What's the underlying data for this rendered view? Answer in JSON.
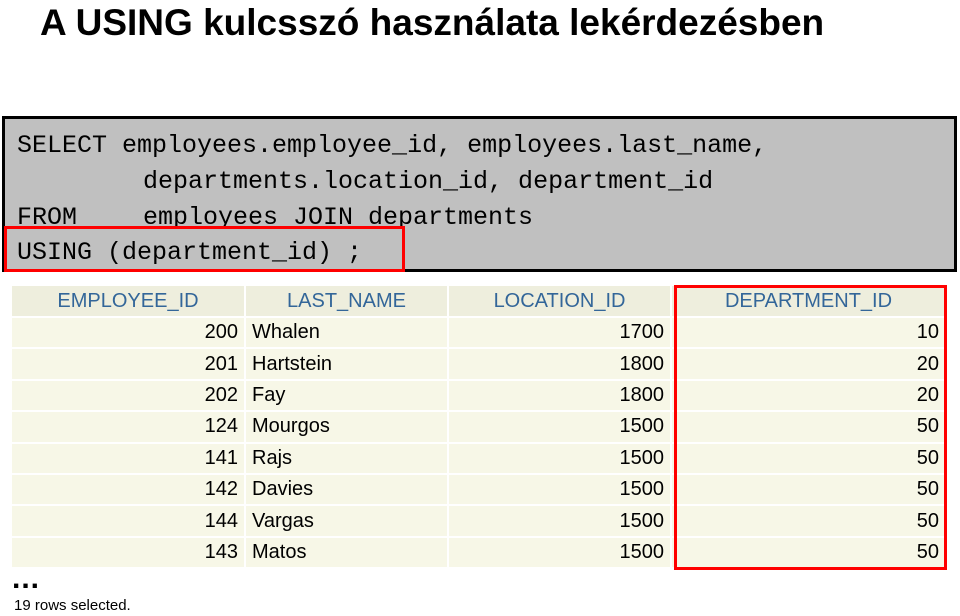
{
  "title": "A USING kulcsszó használata lekérdezésben",
  "sql": {
    "line1": "SELECT employees.employee_id, employees.last_name,",
    "line2": "departments.location_id, department_id",
    "line3_keyword": "FROM",
    "line3_rest": "employees JOIN departments",
    "line4": "USING (department_id) ;"
  },
  "table": {
    "headers": [
      "EMPLOYEE_ID",
      "LAST_NAME",
      "LOCATION_ID",
      "DEPARTMENT_ID"
    ],
    "rows": [
      [
        "200",
        "Whalen",
        "1700",
        "10"
      ],
      [
        "201",
        "Hartstein",
        "1800",
        "20"
      ],
      [
        "202",
        "Fay",
        "1800",
        "20"
      ],
      [
        "124",
        "Mourgos",
        "1500",
        "50"
      ],
      [
        "141",
        "Rajs",
        "1500",
        "50"
      ],
      [
        "142",
        "Davies",
        "1500",
        "50"
      ],
      [
        "144",
        "Vargas",
        "1500",
        "50"
      ],
      [
        "143",
        "Matos",
        "1500",
        "50"
      ]
    ]
  },
  "ellipsis": "...",
  "rows_selected": "19 rows selected.",
  "colors": {
    "highlight": "#ff0000",
    "sql_background": "#c0c0c0",
    "header_text": "#336699",
    "header_background": "#eeeedd",
    "cell_background": "#f7f7e7"
  }
}
